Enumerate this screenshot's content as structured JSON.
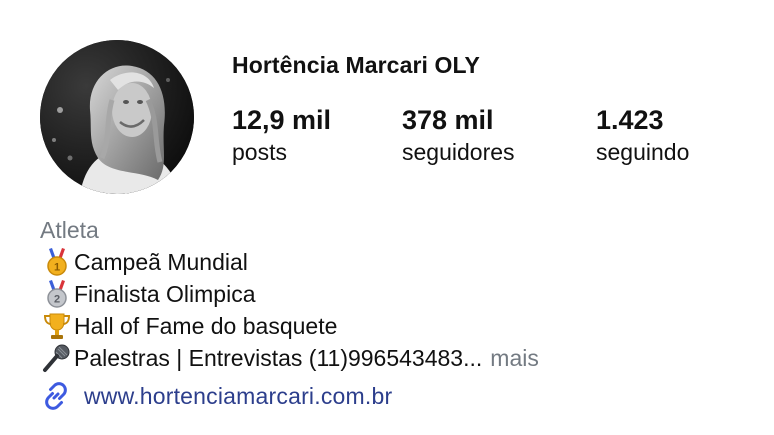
{
  "profile": {
    "display_name": "Hortência Marcari OLY",
    "stats": {
      "posts_value": "12,9 mil",
      "posts_label": "posts",
      "followers_value": "378 mil",
      "followers_label": "seguidores",
      "following_value": "1.423",
      "following_label": "seguindo"
    },
    "bio": {
      "category": "Atleta",
      "lines": [
        {
          "icon": "gold-medal-icon",
          "text": "Campeã Mundial"
        },
        {
          "icon": "silver-medal-icon",
          "text": "Finalista Olimpica"
        },
        {
          "icon": "trophy-icon",
          "text": "Hall of Fame do basquete"
        },
        {
          "icon": "microphone-icon",
          "text": "Palestras | Entrevistas (11)996543483..."
        }
      ],
      "more_label": "mais"
    },
    "link": {
      "icon": "link-icon",
      "url_text": "www.hortenciamarcari.com.br"
    }
  },
  "colors": {
    "text": "#111111",
    "secondary_text": "#737a82",
    "link": "#2c3e8c",
    "link_icon": "#3d5ae0"
  }
}
